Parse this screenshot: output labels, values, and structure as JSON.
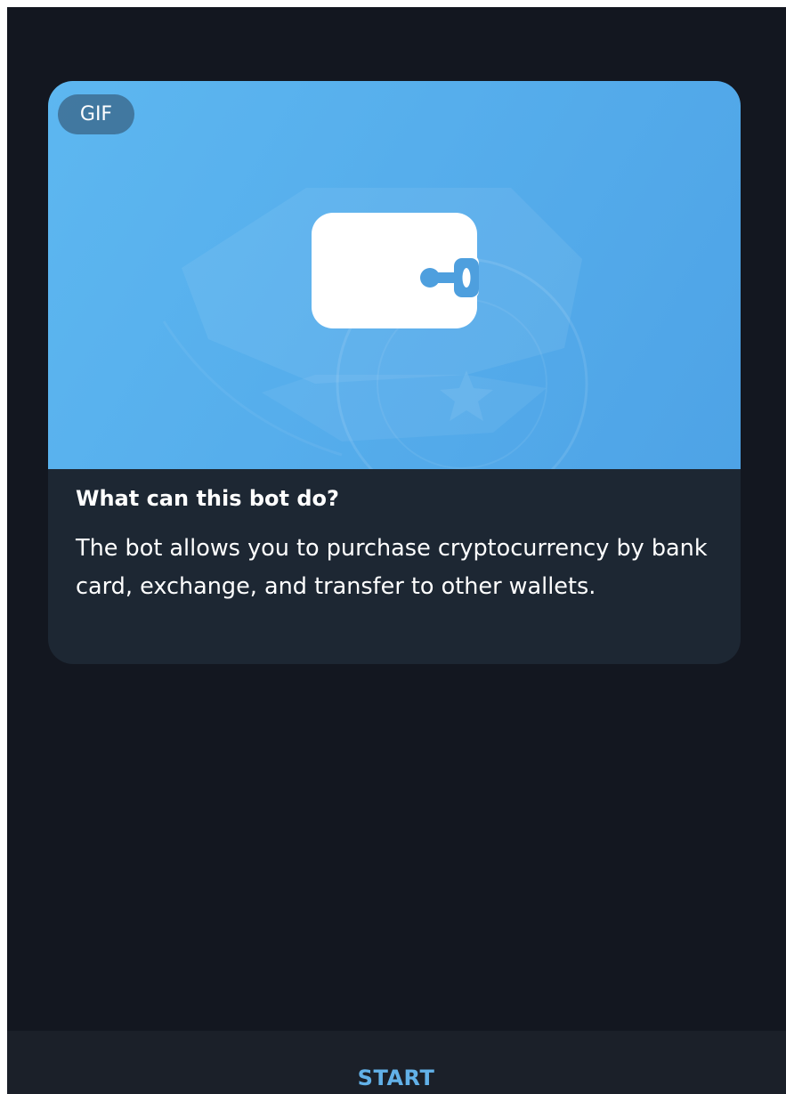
{
  "intro": {
    "media_badge": "GIF",
    "media_icon": "wallet-icon",
    "title": "What can this bot do?",
    "description": "The bot allows you to purchase cryptocurrency by bank card, exchange, and transfer to other wallets."
  },
  "footer": {
    "start_label": "START"
  },
  "colors": {
    "background": "#131720",
    "card": "#1d2733",
    "media_blue": "#56aeec",
    "accent": "#62b1e8",
    "bottom_bar": "#1b2029"
  }
}
